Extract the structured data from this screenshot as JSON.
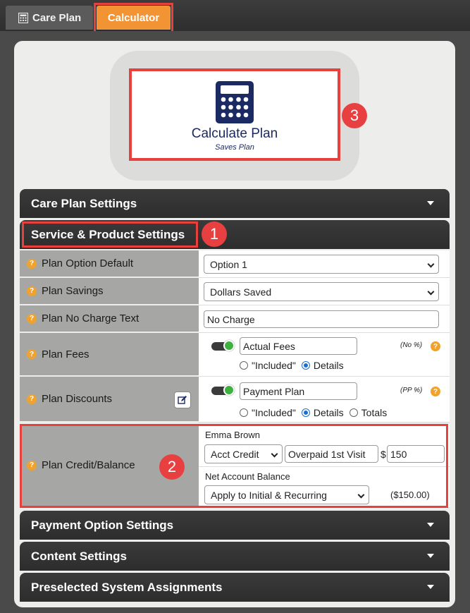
{
  "tabs": {
    "care_plan": "Care Plan",
    "calculator": "Calculator"
  },
  "calculate": {
    "title": "Calculate Plan",
    "subtitle": "Saves Plan"
  },
  "badges": {
    "one": "1",
    "two": "2",
    "three": "3"
  },
  "sections": {
    "care_plan_settings": "Care Plan Settings",
    "service_product_settings": "Service & Product Settings",
    "payment_option_settings": "Payment Option Settings",
    "content_settings": "Content Settings",
    "preselected_system_assignments": "Preselected System Assignments"
  },
  "rows": {
    "plan_option_default": {
      "label": "Plan Option Default",
      "value": "Option 1"
    },
    "plan_savings": {
      "label": "Plan Savings",
      "value": "Dollars Saved"
    },
    "plan_no_charge_text": {
      "label": "Plan No Charge Text",
      "value": "No Charge"
    },
    "plan_fees": {
      "label": "Plan Fees",
      "value": "Actual Fees",
      "note": "(No %)",
      "radio_included": "\"Included\"",
      "radio_details": "Details"
    },
    "plan_discounts": {
      "label": "Plan Discounts",
      "value": "Payment Plan",
      "note": "(PP %)",
      "radio_included": "\"Included\"",
      "radio_details": "Details",
      "radio_totals": "Totals"
    },
    "plan_credit_balance": {
      "label": "Plan Credit/Balance",
      "patient_name": "Emma Brown",
      "credit_type": "Acct Credit",
      "credit_description": "Overpaid 1st Visit",
      "currency_symbol": "$",
      "credit_amount": "150",
      "net_balance_label": "Net Account Balance",
      "apply_option": "Apply to Initial & Recurring",
      "net_balance_value": "($150.00)"
    }
  },
  "colors": {
    "accent_orange": "#f29334",
    "highlight_red": "#e8403c",
    "header_dark": "#2d2d2d",
    "label_gray": "#a6a6a4",
    "help_icon": "#f0a22e",
    "toggle_green": "#3fb13f",
    "calc_navy": "#1b2a63"
  }
}
